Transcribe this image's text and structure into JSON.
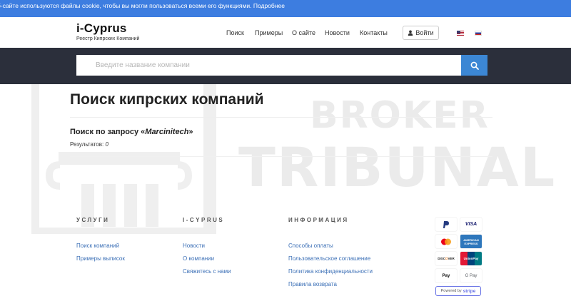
{
  "cookie_banner": {
    "text": "б-сайте используются файлы cookie, чтобы вы могли пользоваться всеми его функциями. Подробнее"
  },
  "brand": {
    "title": "i-Cyprus",
    "subtitle": "Реестр Кипрских Компаний"
  },
  "nav": {
    "items": [
      "Поиск",
      "Примеры",
      "О сайте",
      "Новости",
      "Контакты"
    ],
    "login_label": "Войти"
  },
  "search": {
    "placeholder": "Введите название компании"
  },
  "watermark": {
    "line1": "BROKER",
    "line2": "TRIBUNAL"
  },
  "main": {
    "title": "Поиск кипрских компаний",
    "query_prefix": "Поиск по запросу «",
    "query": "Marcinitech",
    "query_suffix": "»",
    "results_label": "Результатов:",
    "results_count": "0"
  },
  "footer": {
    "columns": [
      {
        "heading": "УСЛУГИ",
        "links": [
          "Поиск компаний",
          "Примеры выписок"
        ]
      },
      {
        "heading": "I-CYPRUS",
        "links": [
          "Новости",
          "О компании",
          "Свяжитесь с нами"
        ]
      },
      {
        "heading": "ИНФОРМАЦИЯ",
        "links": [
          "Способы оплаты",
          "Пользовательское соглашение",
          "Политика конфиденциальности",
          "Правила возврата"
        ]
      }
    ],
    "payments": {
      "cards": [
        "PayPal",
        "VISA",
        "Mastercard",
        "AMERICAN EXPRESS",
        "DISCOVER",
        "UnionPay",
        "Apple Pay",
        "G Pay"
      ],
      "stripe_prefix": "Powered by",
      "stripe_name": "stripe"
    }
  },
  "colors": {
    "cookie_bar": "#3d7de0",
    "search_band": "#2b2f3b",
    "search_button": "#3c87d4",
    "link": "#3b6fb6"
  }
}
